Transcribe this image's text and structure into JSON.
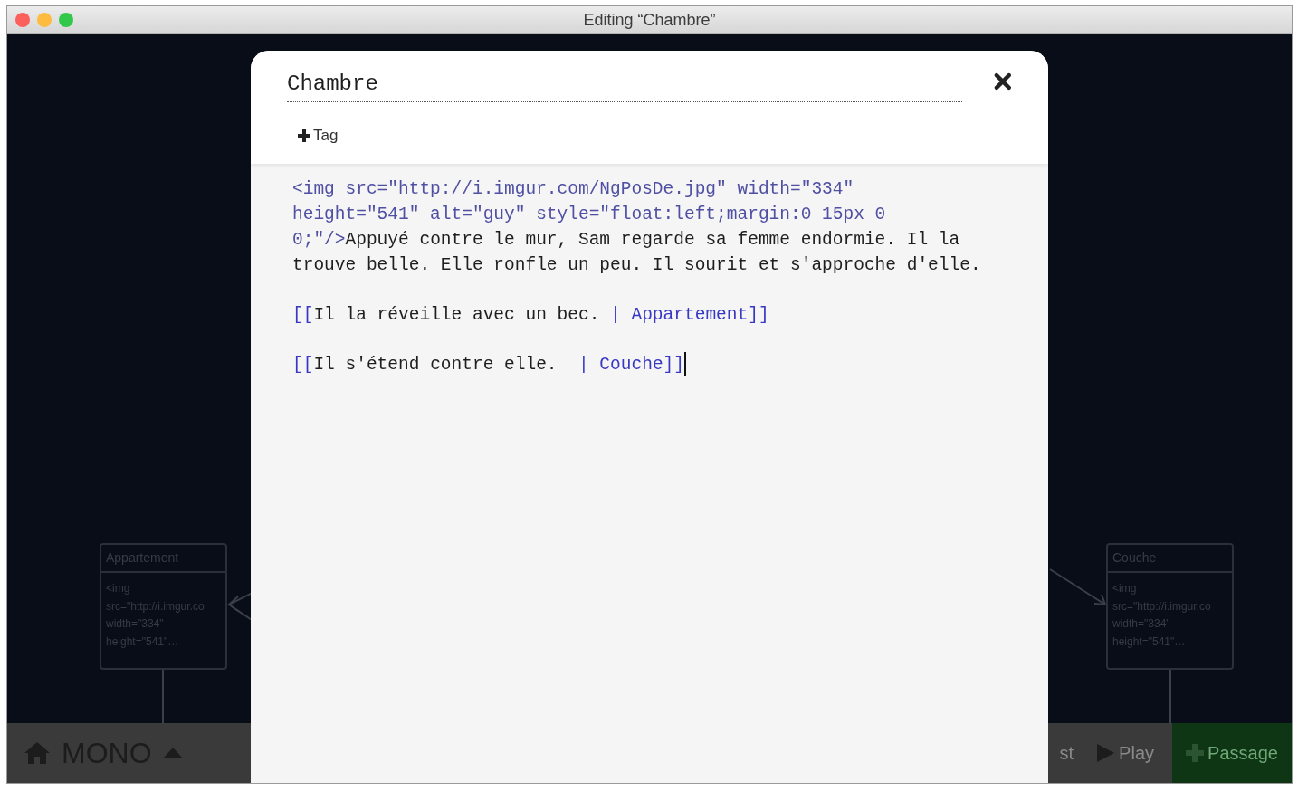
{
  "window": {
    "title": "Editing “Chambre”"
  },
  "story_map": {
    "passages": [
      {
        "title": "Appartement",
        "excerpt_lines": [
          "<img",
          "src=\"http://i.imgur.co",
          "width=\"334\"",
          "height=\"541\"…"
        ]
      },
      {
        "title": "Couche",
        "excerpt_lines": [
          "<img",
          "src=\"http://i.imgur.co",
          "width=\"334\"",
          "height=\"541\"…"
        ]
      }
    ]
  },
  "toolbar": {
    "story_menu": {
      "label": "MONO"
    },
    "buttons": [
      {
        "kind": "text",
        "label": "st"
      },
      {
        "kind": "play",
        "label": "Play"
      },
      {
        "kind": "add",
        "label": "Passage"
      }
    ]
  },
  "editor": {
    "name_field": {
      "value": "Chambre"
    },
    "tag_button": {
      "label": "Tag"
    },
    "paragraphs": [
      [
        {
          "kind": "markup",
          "text": "<img src=\"http://i.imgur.com/NgPosDe.jpg\" width=\"334\" height=\"541\" alt=\"guy\" style=\"float:left;margin:0 15px 0 0;\"/>"
        },
        {
          "kind": "prose",
          "text": "Appuyé contre le mur, Sam regarde sa femme endormie. Il la trouve belle. Elle ronfle un peu. Il sourit et s'approche d'elle."
        }
      ],
      [
        {
          "kind": "link",
          "text": "[["
        },
        {
          "kind": "prose",
          "text": "Il la réveille avec un bec. "
        },
        {
          "kind": "link",
          "text": "| Appartement]]"
        }
      ],
      [
        {
          "kind": "link",
          "text": "[["
        },
        {
          "kind": "prose",
          "text": "Il s'étend contre elle.  "
        },
        {
          "kind": "link",
          "text": "| Couche]]"
        }
      ]
    ]
  }
}
